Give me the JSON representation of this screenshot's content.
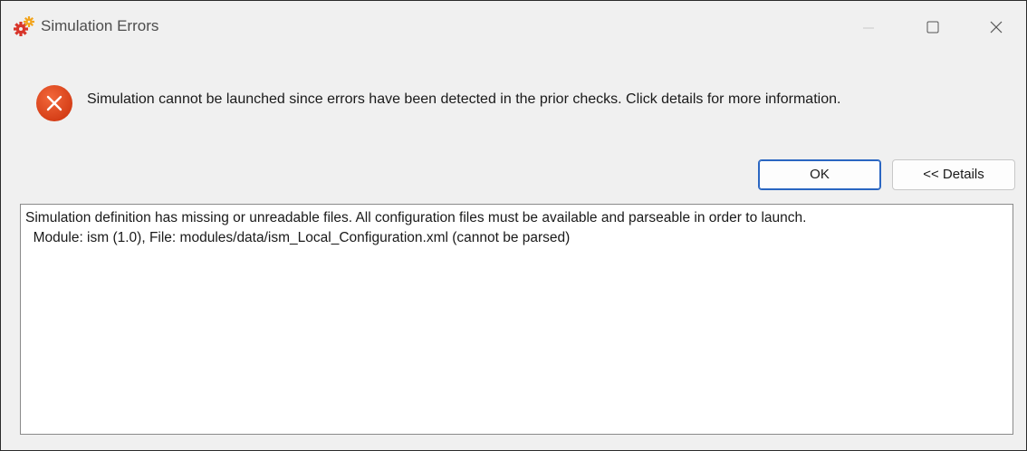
{
  "window": {
    "title": "Simulation Errors"
  },
  "icons": {
    "app": "gears-icon",
    "error": "error-icon",
    "minimize": "minimize-icon",
    "maximize": "maximize-icon",
    "close": "close-icon"
  },
  "colors": {
    "error_red": "#e04a1f",
    "default_button_border": "#2a66c2",
    "app_icon_red": "#d8352a",
    "app_icon_orange": "#f2a41c"
  },
  "message": {
    "text": "Simulation cannot be launched since errors have been detected in the prior checks. Click details for more information."
  },
  "buttons": {
    "ok_label": "OK",
    "details_label": "<< Details"
  },
  "details": {
    "lines": [
      "Simulation definition has missing or unreadable files. All configuration files must be available and parseable in order to launch.",
      "  Module: ism (1.0), File: modules/data/ism_Local_Configuration.xml (cannot be parsed)"
    ]
  }
}
